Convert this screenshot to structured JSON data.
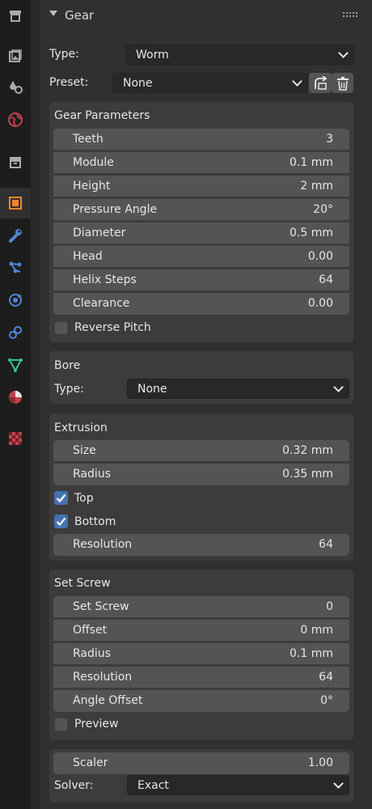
{
  "sidebar": {
    "tabs": [
      {
        "icon": "tool-icon",
        "color": "#aaaaaa",
        "active": false
      },
      {
        "icon": "render-icon",
        "color": "#aaaaaa",
        "active": false
      },
      {
        "icon": "output-icon",
        "color": "#aaaaaa",
        "active": false
      },
      {
        "icon": "view-layer-icon",
        "color": "#aaaaaa",
        "active": false
      },
      {
        "icon": "scene-icon",
        "color": "#aaaaaa",
        "active": false
      },
      {
        "icon": "world-icon",
        "color": "#c0434b",
        "active": false
      },
      {
        "icon": "collection-icon",
        "color": "#aaaaaa",
        "active": false
      },
      {
        "icon": "object-icon",
        "color": "#e8892f",
        "active": true
      },
      {
        "icon": "modifier-icon",
        "color": "#4f86d6",
        "active": false
      },
      {
        "icon": "particles-icon",
        "color": "#4f86d6",
        "active": false
      },
      {
        "icon": "physics-icon",
        "color": "#4f86d6",
        "active": false
      },
      {
        "icon": "constraints-icon",
        "color": "#4f86d6",
        "active": false
      },
      {
        "icon": "data-icon",
        "color": "#36c28a",
        "active": false
      },
      {
        "icon": "material-icon",
        "color": "#c0434b",
        "active": false
      },
      {
        "icon": "texture-icon",
        "color": "#c0434b",
        "active": false
      }
    ]
  },
  "header": {
    "title": "Gear"
  },
  "type_row": {
    "label": "Type:",
    "value": "Worm"
  },
  "preset_row": {
    "label": "Preset:",
    "value": "None"
  },
  "gear_params": {
    "title": "Gear Parameters",
    "fields": [
      {
        "label": "Teeth",
        "value": "3"
      },
      {
        "label": "Module",
        "value": "0.1 mm"
      },
      {
        "label": "Height",
        "value": "2 mm"
      },
      {
        "label": "Pressure Angle",
        "value": "20°"
      },
      {
        "label": "Diameter",
        "value": "0.5 mm"
      },
      {
        "label": "Head",
        "value": "0.00"
      },
      {
        "label": "Helix Steps",
        "value": "64"
      },
      {
        "label": "Clearance",
        "value": "0.00"
      }
    ],
    "reverse_pitch": {
      "label": "Reverse Pitch",
      "checked": false
    }
  },
  "bore": {
    "title": "Bore",
    "type_label": "Type:",
    "type_value": "None"
  },
  "extrusion": {
    "title": "Extrusion",
    "fields": [
      {
        "label": "Size",
        "value": "0.32 mm"
      },
      {
        "label": "Radius",
        "value": "0.35 mm"
      }
    ],
    "top": {
      "label": "Top",
      "checked": true
    },
    "bottom": {
      "label": "Bottom",
      "checked": true
    },
    "resolution": {
      "label": "Resolution",
      "value": "64"
    }
  },
  "set_screw": {
    "title": "Set Screw",
    "fields": [
      {
        "label": "Set Screw",
        "value": "0"
      },
      {
        "label": "Offset",
        "value": "0 mm"
      },
      {
        "label": "Radius",
        "value": "0.1 mm"
      },
      {
        "label": "Resolution",
        "value": "64"
      },
      {
        "label": "Angle Offset",
        "value": "0°"
      }
    ],
    "preview": {
      "label": "Preview",
      "checked": false
    }
  },
  "solver_panel": {
    "scaler": {
      "label": "Scaler",
      "value": "1.00"
    },
    "solver_label": "Solver:",
    "solver_value": "Exact"
  }
}
